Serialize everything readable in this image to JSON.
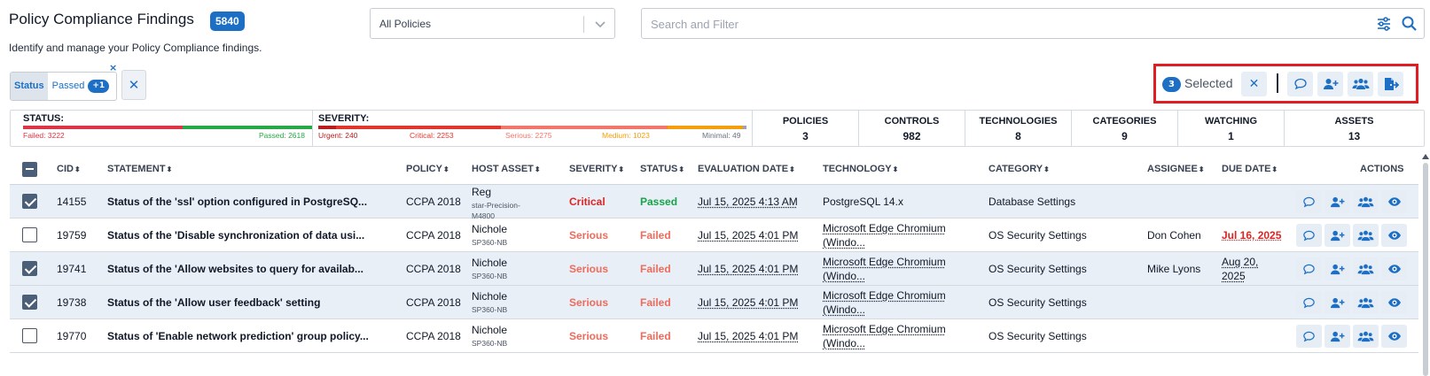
{
  "header": {
    "title": "Policy Compliance Findings",
    "count": "5840",
    "subtitle": "Identify and manage your Policy Compliance findings.",
    "policy_select": "All Policies",
    "search_placeholder": "Search and Filter"
  },
  "filter_chip": {
    "key": "Status",
    "value": "Passed",
    "extra": "+1",
    "remove": "×",
    "clear": "✕"
  },
  "selection": {
    "count": "3",
    "label": "Selected",
    "clear": "✕"
  },
  "summary": {
    "status": {
      "label": "STATUS:",
      "failed_label": "Failed: 3222",
      "passed_label": "Passed: 2618",
      "failed": 3222,
      "passed": 2618
    },
    "severity": {
      "label": "SEVERITY:",
      "urgent_label": "Urgent: 240",
      "critical_label": "Critical: 2253",
      "serious_label": "Serious: 2275",
      "medium_label": "Medium: 1023",
      "minimal_label": "Minimal: 49",
      "values": {
        "urgent": 240,
        "critical": 2253,
        "serious": 2275,
        "medium": 1023,
        "minimal": 49
      }
    },
    "stats": [
      {
        "label": "POLICIES",
        "value": "3"
      },
      {
        "label": "CONTROLS",
        "value": "982"
      },
      {
        "label": "TECHNOLOGIES",
        "value": "8"
      },
      {
        "label": "CATEGORIES",
        "value": "9"
      },
      {
        "label": "WATCHING",
        "value": "1"
      },
      {
        "label": "ASSETS",
        "value": "13"
      }
    ]
  },
  "columns": {
    "cid": "CID",
    "statement": "STATEMENT",
    "policy": "POLICY",
    "host_asset": "HOST ASSET",
    "severity": "SEVERITY",
    "status": "STATUS",
    "evaluation_date": "EVALUATION DATE",
    "technology": "TECHNOLOGY",
    "category": "CATEGORY",
    "assignee": "ASSIGNEE",
    "due_date": "DUE DATE",
    "actions": "ACTIONS"
  },
  "rows": [
    {
      "selected": true,
      "cid": "14155",
      "statement": "Status of the 'ssl' option configured in PostgreSQ...",
      "policy": "CCPA 2018",
      "host": "Reg",
      "host_sub1": "star-Precision-",
      "host_sub2": "M4800",
      "severity": "Critical",
      "status": "Passed",
      "eval_date": "Jul 15, 2025 4:13 AM",
      "tech1": "PostgreSQL 14.x",
      "tech2": "",
      "category": "Database Settings",
      "assignee": "",
      "due1": "",
      "due2": ""
    },
    {
      "selected": false,
      "cid": "19759",
      "statement": "Status of the 'Disable synchronization of data usi...",
      "policy": "CCPA 2018",
      "host": "Nichole",
      "host_sub1": "SP360-NB",
      "host_sub2": "",
      "severity": "Serious",
      "status": "Failed",
      "eval_date": "Jul 15, 2025 4:01 PM",
      "tech1": "Microsoft Edge Chromium",
      "tech2": "(Windo...",
      "category": "OS Security Settings",
      "assignee": "Don Cohen",
      "due1": "Jul 16, 2025",
      "due2": ""
    },
    {
      "selected": true,
      "cid": "19741",
      "statement": "Status of the 'Allow websites to query for availab...",
      "policy": "CCPA 2018",
      "host": "Nichole",
      "host_sub1": "SP360-NB",
      "host_sub2": "",
      "severity": "Serious",
      "status": "Failed",
      "eval_date": "Jul 15, 2025 4:01 PM",
      "tech1": "Microsoft Edge Chromium",
      "tech2": "(Windo...",
      "category": "OS Security Settings",
      "assignee": "Mike Lyons",
      "due1": "Aug 20,",
      "due2": "2025"
    },
    {
      "selected": true,
      "cid": "19738",
      "statement": "Status of the 'Allow user feedback' setting",
      "policy": "CCPA 2018",
      "host": "Nichole",
      "host_sub1": "SP360-NB",
      "host_sub2": "",
      "severity": "Serious",
      "status": "Failed",
      "eval_date": "Jul 15, 2025 4:01 PM",
      "tech1": "Microsoft Edge Chromium",
      "tech2": "(Windo...",
      "category": "OS Security Settings",
      "assignee": "",
      "due1": "",
      "due2": ""
    },
    {
      "selected": false,
      "cid": "19770",
      "statement": "Status of 'Enable network prediction' group policy...",
      "policy": "CCPA 2018",
      "host": "Nichole",
      "host_sub1": "SP360-NB",
      "host_sub2": "",
      "severity": "Serious",
      "status": "Failed",
      "eval_date": "Jul 15, 2025 4:01 PM",
      "tech1": "Microsoft Edge Chromium",
      "tech2": "(Windo...",
      "category": "OS Security Settings",
      "assignee": "",
      "due1": "",
      "due2": ""
    }
  ],
  "colors": {
    "accent": "#1c6fc5",
    "highlight_border": "#e11d24",
    "failed": "#dc3545",
    "passed": "#28a745",
    "urgent": "#b91c1c",
    "critical": "#e0362d",
    "serious": "#f2776a",
    "medium": "#f59e0b",
    "minimal": "#9ca3af"
  }
}
